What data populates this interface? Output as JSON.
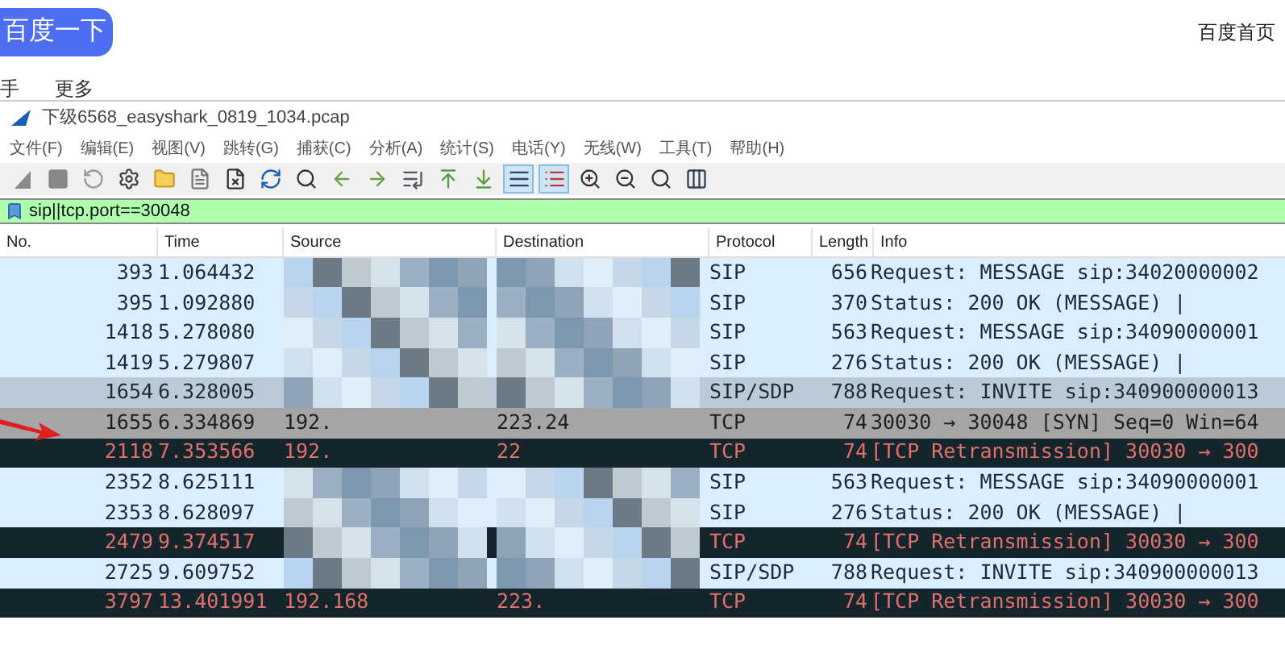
{
  "browser": {
    "search_button": "百度一下",
    "home_link": "百度首页",
    "nav": [
      "手",
      "更多"
    ]
  },
  "window": {
    "title": "下级6568_easyshark_0819_1034.pcap"
  },
  "menu": [
    "文件(F)",
    "编辑(E)",
    "视图(V)",
    "跳转(G)",
    "捕获(C)",
    "分析(A)",
    "统计(S)",
    "电话(Y)",
    "无线(W)",
    "工具(T)",
    "帮助(H)"
  ],
  "toolbar": [
    {
      "selected": false
    },
    {
      "selected": false
    },
    {
      "selected": false
    },
    {
      "selected": false
    },
    {
      "selected": false
    },
    {
      "selected": false
    },
    {
      "selected": false
    },
    {
      "selected": false
    },
    {
      "selected": false
    },
    {
      "selected": false
    },
    {
      "selected": false
    },
    {
      "selected": false
    },
    {
      "selected": false
    },
    {
      "selected": false
    },
    {
      "selected": true
    },
    {
      "selected": true
    },
    {
      "selected": false
    },
    {
      "selected": false
    },
    {
      "selected": false
    },
    {
      "selected": false
    }
  ],
  "filter": {
    "value": "sip||tcp.port==30048"
  },
  "table": {
    "columns": [
      "No.",
      "Time",
      "Source",
      "Destination",
      "Protocol",
      "Length",
      "Info"
    ],
    "rows": [
      {
        "kind": "sip",
        "no": "393",
        "time": "1.064432",
        "protocol": "SIP",
        "length": "656",
        "info": "Request: MESSAGE sip:34020000002"
      },
      {
        "kind": "sip",
        "no": "395",
        "time": "1.092880",
        "protocol": "SIP",
        "length": "370",
        "info": "Status: 200 OK (MESSAGE) |"
      },
      {
        "kind": "sip",
        "no": "1418",
        "time": "5.278080",
        "protocol": "SIP",
        "length": "563",
        "info": "Request: MESSAGE sip:34090000001"
      },
      {
        "kind": "sip",
        "no": "1419",
        "time": "5.279807",
        "protocol": "SIP",
        "length": "276",
        "info": "Status: 200 OK (MESSAGE) |"
      },
      {
        "kind": "sip-marked",
        "no": "1654",
        "time": "6.328005",
        "protocol": "SIP/SDP",
        "length": "788",
        "info": "Request: INVITE sip:340900000013"
      },
      {
        "kind": "syn",
        "no": "1655",
        "time": "6.334869",
        "source": "192.",
        "destination": "223.24",
        "protocol": "TCP",
        "length": "74",
        "info": "30030 → 30048 [SYN] Seq=0 Win=64"
      },
      {
        "kind": "retransmission",
        "no": "2118",
        "time": "7.353566",
        "source": "192.",
        "destination": "22",
        "protocol": "TCP",
        "length": "74",
        "info": "[TCP Retransmission] 30030 → 300"
      },
      {
        "kind": "sip",
        "no": "2352",
        "time": "8.625111",
        "protocol": "SIP",
        "length": "563",
        "info": "Request: MESSAGE sip:34090000001"
      },
      {
        "kind": "sip",
        "no": "2353",
        "time": "8.628097",
        "protocol": "SIP",
        "length": "276",
        "info": "Status: 200 OK (MESSAGE) |"
      },
      {
        "kind": "retransmission",
        "no": "2479",
        "time": "9.374517",
        "protocol": "TCP",
        "length": "74",
        "info": "[TCP Retransmission] 30030 → 300"
      },
      {
        "kind": "sip",
        "no": "2725",
        "time": "9.609752",
        "protocol": "SIP/SDP",
        "length": "788",
        "info": "Request: INVITE sip:340900000013"
      },
      {
        "kind": "retransmission",
        "no": "3797",
        "time": "13.401991",
        "source": "192.168",
        "destination": "223.",
        "protocol": "TCP",
        "length": "74",
        "info": "[TCP Retransmission] 30030 → 300"
      }
    ]
  }
}
